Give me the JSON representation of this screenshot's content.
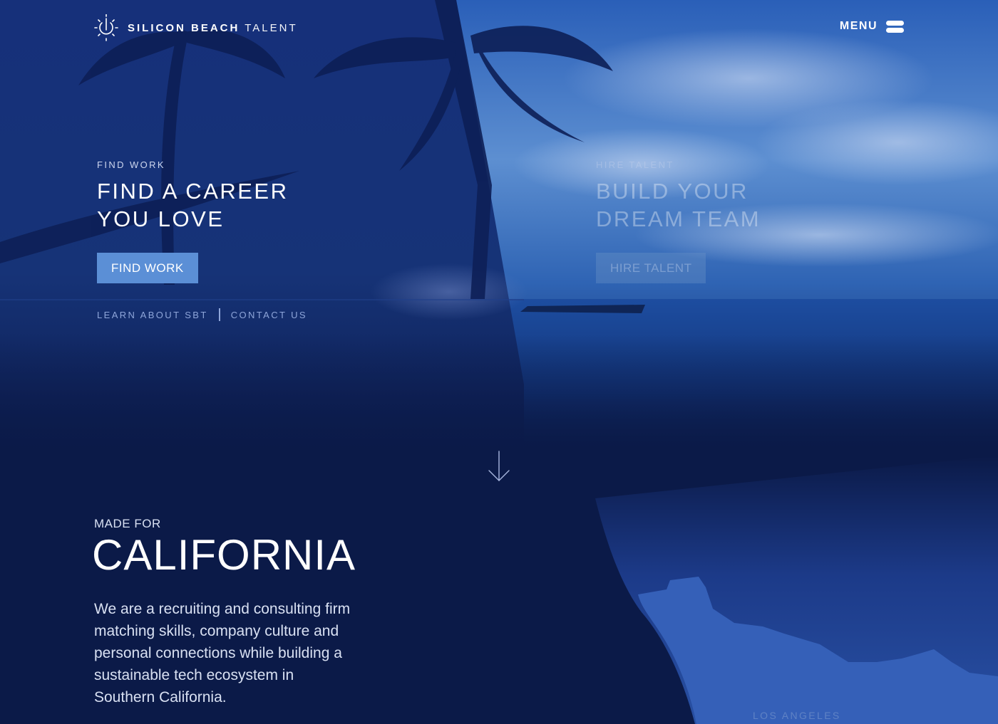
{
  "header": {
    "logo_bold": "SILICON BEACH",
    "logo_light": "TALENT",
    "menu_label": "MENU"
  },
  "hero": {
    "left": {
      "eyebrow": "FIND WORK",
      "headline_line1": "FIND A CAREER",
      "headline_line2": "YOU LOVE",
      "cta_label": "FIND WORK"
    },
    "right": {
      "eyebrow": "HIRE TALENT",
      "headline_line1": "BUILD YOUR",
      "headline_line2": "DREAM TEAM",
      "cta_label": "HIRE TALENT"
    },
    "links": {
      "learn": "LEARN ABOUT SBT",
      "contact": "CONTACT US"
    }
  },
  "california": {
    "eyebrow": "MADE FOR",
    "title": "CALIFORNIA",
    "body": "We are a recruiting and consulting firm matching skills, company culture and personal connections while building a sustainable tech ecosystem in Southern California.",
    "map_label": "LOS ANGELES"
  },
  "colors": {
    "page_bg": "#0b1a48",
    "accent_button": "#5b8fd6",
    "map_land": "#3560b8",
    "link_text": "#8fa6da"
  },
  "icons": [
    "logo-sun-icon",
    "menu-icon",
    "scroll-down-arrow-icon"
  ]
}
